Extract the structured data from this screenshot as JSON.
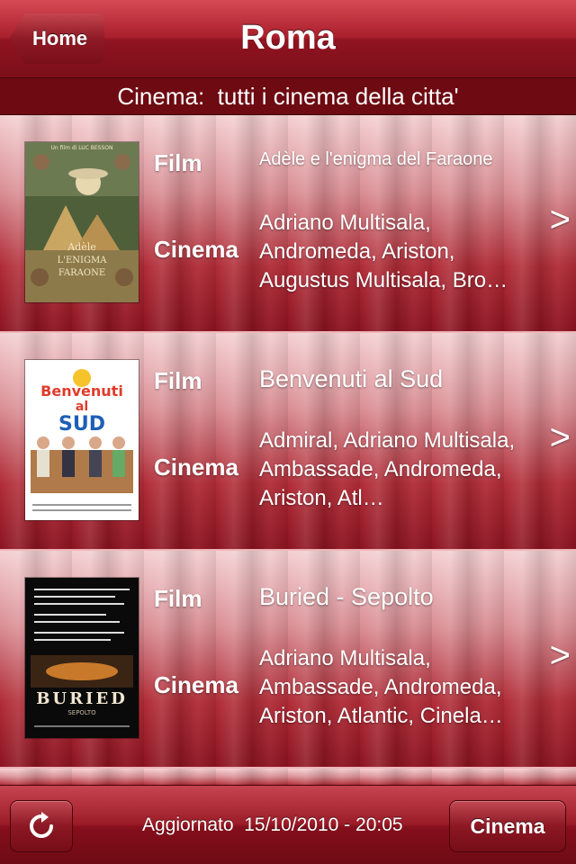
{
  "header": {
    "back_label": "Home",
    "title": "Roma"
  },
  "subheader": {
    "text": "Cinema:  tutti i cinema della citta'"
  },
  "labels": {
    "film": "Film",
    "cinema": "Cinema"
  },
  "movies": [
    {
      "title": "Adèle e l'enigma del Faraone",
      "cinemas": "Adriano Multisala, Andromeda, Ariston, Augustus Multisala, Bro…",
      "poster_icon": "poster-adele",
      "poster_colors": [
        "#6b7a4a",
        "#d8c48a",
        "#3d4a32"
      ]
    },
    {
      "title": "Benvenuti al Sud",
      "cinemas": "Admiral, Adriano Multisala, Ambassade, Andromeda, Ariston, Atl…",
      "poster_icon": "poster-benvenuti",
      "poster_colors": [
        "#ffffff",
        "#e23a2a",
        "#1d5fb6"
      ]
    },
    {
      "title": "Buried - Sepolto",
      "cinemas": "Adriano Multisala, Ambassade, Andromeda, Ariston, Atlantic, Cinela…",
      "poster_icon": "poster-buried",
      "poster_colors": [
        "#0a0a0a",
        "#c87a2a",
        "#f2e6d0"
      ]
    }
  ],
  "toolbar": {
    "refresh_icon": "refresh-icon",
    "updated_text": "Aggiornato  15/10/2010 - 20:05",
    "cinema_button": "Cinema"
  },
  "colors": {
    "accent": "#8e1420",
    "text": "#ffffff"
  }
}
